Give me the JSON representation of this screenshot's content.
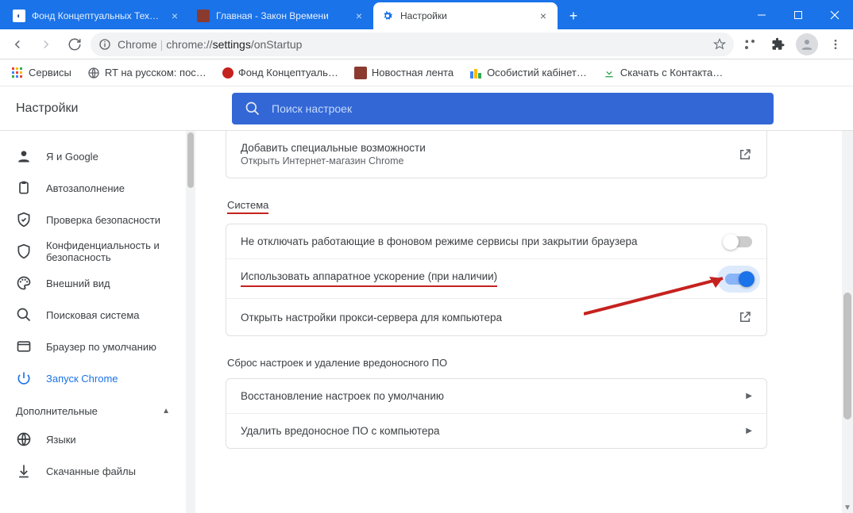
{
  "window": {
    "tabs": [
      {
        "title": "Фонд Концептуальных Техноло",
        "favicon_bg": "#ffffff",
        "favicon_fg": "#3b5998"
      },
      {
        "title": "Главная - Закон Времени",
        "favicon_bg": "#8b3a2f",
        "favicon_fg": "#ffffff"
      },
      {
        "title": "Настройки",
        "favicon_bg": "transparent",
        "favicon_fg": "#1a73e8"
      }
    ],
    "active_tab_index": 2
  },
  "toolbar": {
    "address_prefix": "Chrome",
    "address_url_host": "chrome://",
    "address_url_path_strong": "settings",
    "address_url_path_rest": "/onStartup"
  },
  "bookmarks": [
    {
      "label": "Сервисы",
      "icon": "apps-grid",
      "color": "#5f6368"
    },
    {
      "label": "RT на русском: пос…",
      "icon": "globe",
      "color": "#5f6368"
    },
    {
      "label": "Фонд Концептуаль…",
      "icon": "dot",
      "color": "#c5221f"
    },
    {
      "label": "Новостная лента",
      "icon": "square",
      "color": "#8b3a2f"
    },
    {
      "label": "Особистий кабінет…",
      "icon": "bars",
      "color": "#34a853"
    },
    {
      "label": "Скачать с Контакта…",
      "icon": "download",
      "color": "#34a853"
    }
  ],
  "settings": {
    "title": "Настройки",
    "search_placeholder": "Поиск настроек",
    "sidebar": {
      "items": [
        {
          "label": "Я и Google",
          "icon": "person"
        },
        {
          "label": "Автозаполнение",
          "icon": "clipboard"
        },
        {
          "label": "Проверка безопасности",
          "icon": "shield-check"
        },
        {
          "label": "Конфиденциальность и безопасность",
          "icon": "shield"
        },
        {
          "label": "Внешний вид",
          "icon": "palette"
        },
        {
          "label": "Поисковая система",
          "icon": "search"
        },
        {
          "label": "Браузер по умолчанию",
          "icon": "browser"
        },
        {
          "label": "Запуск Chrome",
          "icon": "power"
        }
      ],
      "active_index": 7,
      "advanced_label": "Дополнительные",
      "advanced_items": [
        {
          "label": "Языки",
          "icon": "globe"
        },
        {
          "label": "Скачанные файлы",
          "icon": "download"
        }
      ]
    },
    "content": {
      "accessibility_row": {
        "title": "Добавить специальные возможности",
        "subtitle": "Открыть Интернет-магазин Chrome"
      },
      "system_section_label": "Система",
      "system_rows": [
        {
          "label": "Не отключать работающие в фоновом режиме сервисы при закрытии браузера",
          "type": "toggle",
          "value": false
        },
        {
          "label": "Использовать аппаратное ускорение (при наличии)",
          "type": "toggle",
          "value": true,
          "underlined": true,
          "highlight": true
        },
        {
          "label": "Открыть настройки прокси-сервера для компьютера",
          "type": "external"
        }
      ],
      "reset_section_label": "Сброс настроек и удаление вредоносного ПО",
      "reset_rows": [
        {
          "label": "Восстановление настроек по умолчанию"
        },
        {
          "label": "Удалить вредоносное ПО с компьютера"
        }
      ]
    }
  },
  "colors": {
    "accent": "#1a73e8"
  }
}
